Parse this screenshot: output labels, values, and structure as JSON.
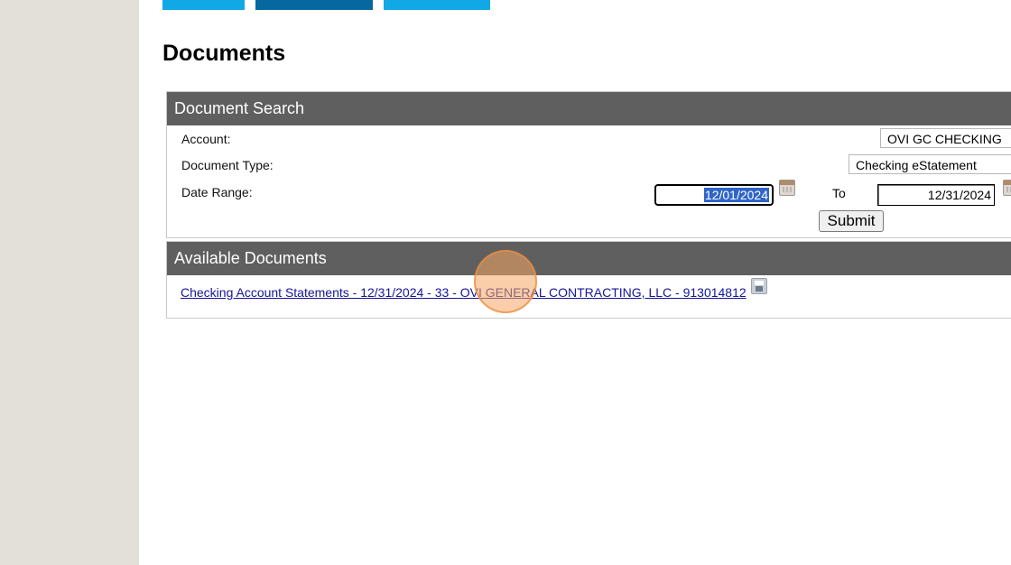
{
  "page": {
    "title": "Documents"
  },
  "search_panel": {
    "header": "Document Search",
    "account_label": "Account:",
    "account_value": "OVI GC CHECKING",
    "doc_type_label": "Document Type:",
    "doc_type_value": "Checking eStatement",
    "date_range_label": "Date Range:",
    "date_from": "12/01/2024",
    "to_label": "To",
    "date_to": "12/31/2024",
    "submit_label": "Submit"
  },
  "documents_panel": {
    "header": "Available Documents",
    "items": [
      {
        "link_text": "Checking Account Statements - 12/31/2024 - 33 - OVI GENERAL CONTRACTING, LLC - 913014812"
      }
    ]
  },
  "colors": {
    "rail": "#e3e0da",
    "tab_light": "#10a9e6",
    "tab_dark": "#07679f",
    "panel_header": "#5f5f5f",
    "link": "#15159a",
    "selection": "#2f65c7",
    "click_marker": "#f6a662"
  },
  "icons": [
    "calendar-icon",
    "calendar-icon",
    "save-disk-icon",
    "chevron-down-icon"
  ]
}
